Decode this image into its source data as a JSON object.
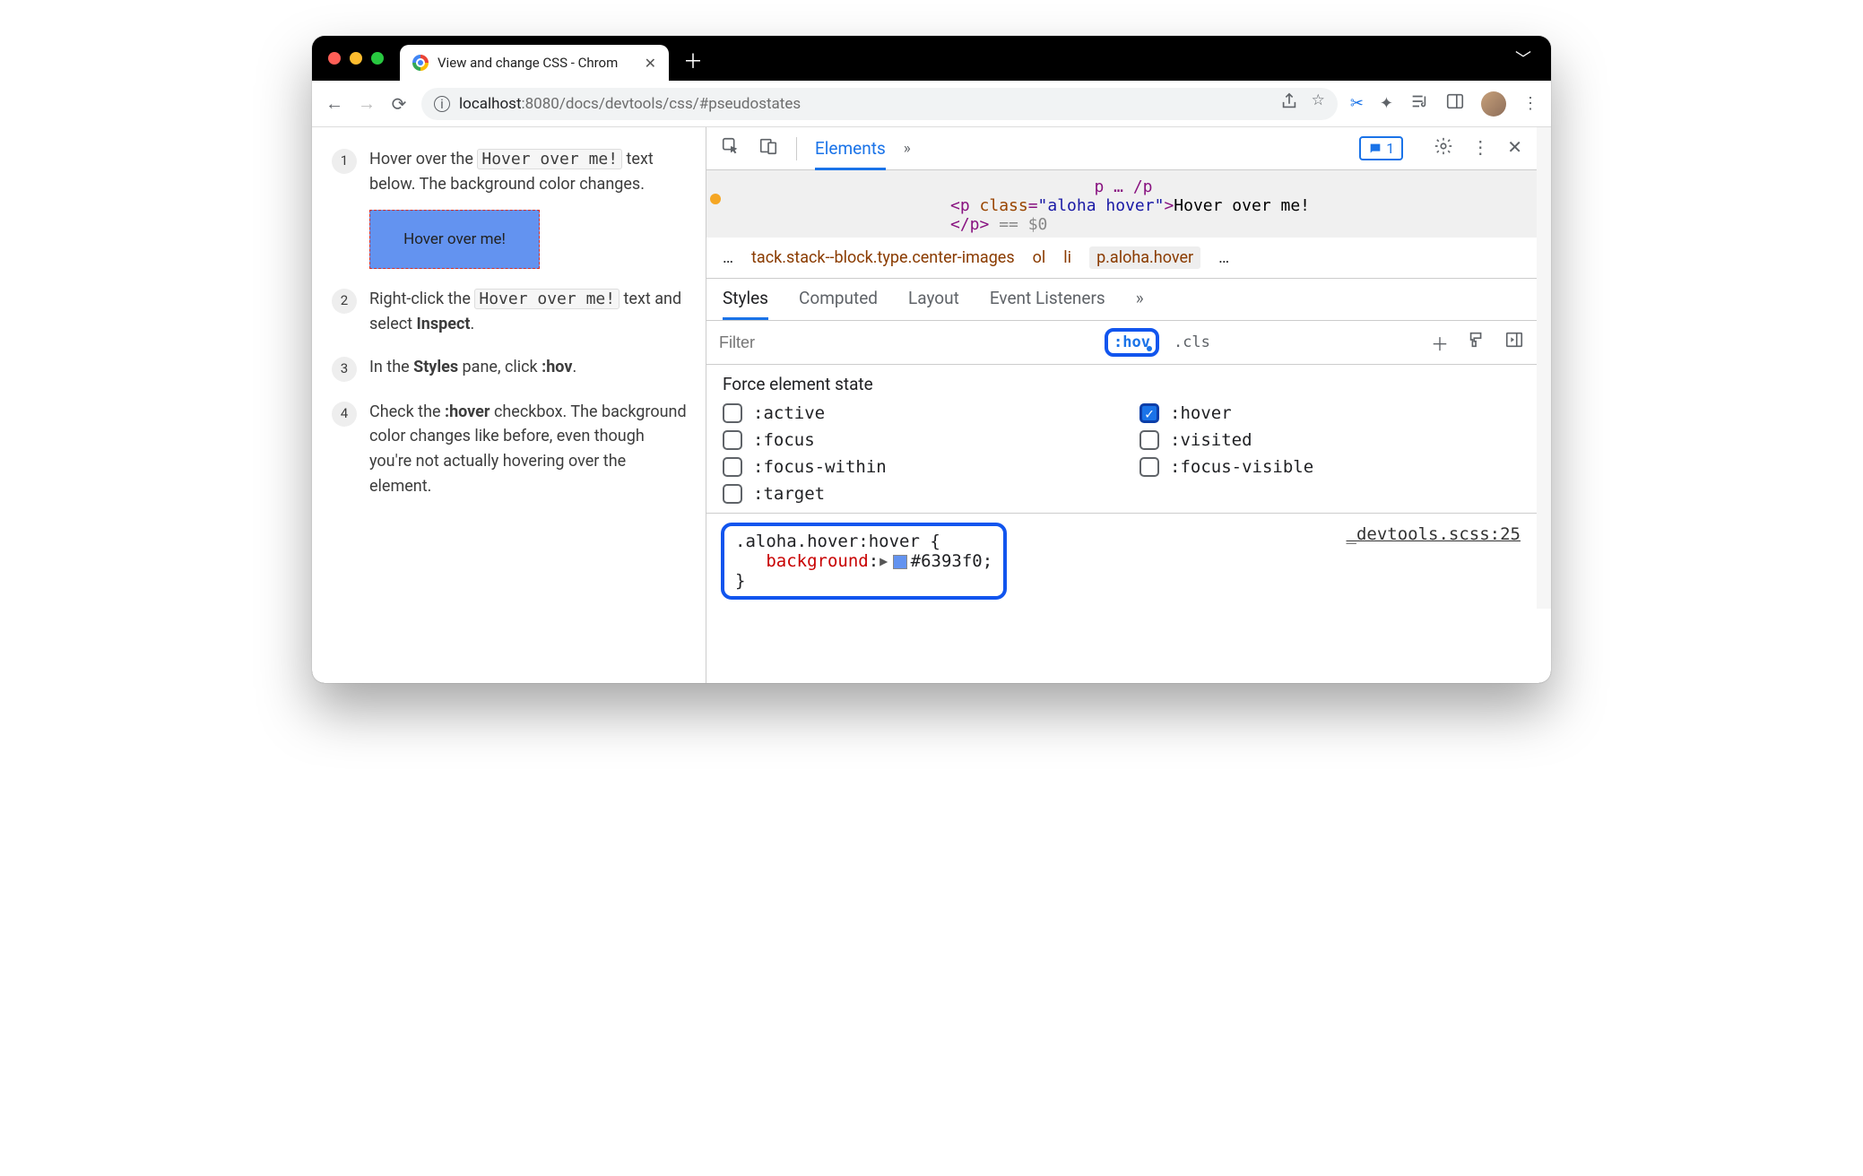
{
  "tab": {
    "title": "View and change CSS - Chrom"
  },
  "url": {
    "host": "localhost",
    "port": ":8080",
    "path": "/docs/devtools/css/#pseudostates"
  },
  "page": {
    "steps": [
      {
        "n": "1",
        "pre": "Hover over the ",
        "code": "Hover over me!",
        "post": " text below. The background color changes."
      },
      {
        "n": "2",
        "pre": "Right-click the ",
        "code": "Hover over me!",
        "post": " text and select ",
        "bold": "Inspect",
        "tail": "."
      },
      {
        "n": "3",
        "pre": "In the ",
        "bold": "Styles",
        "mid": " pane, click ",
        "bold2": ":hov",
        "tail": "."
      },
      {
        "n": "4",
        "pre": "Check the ",
        "bold": ":hover",
        "post": " checkbox. The background color changes like before, even though you're not actually hovering over the element."
      }
    ],
    "hover_demo": "Hover over me!"
  },
  "devtools": {
    "panel": "Elements",
    "issues_count": "1",
    "dom": {
      "tag_open": "<p ",
      "class_attr": "class",
      "class_val": "\"aloha hover\"",
      "text": "Hover over me!",
      "tag_close": "</p>",
      "var": "== $0"
    },
    "crumbs": {
      "ellipsis": "…",
      "long": "tack.stack--block.type.center-images",
      "ol": "ol",
      "li": "li",
      "sel": "p.aloha.hover",
      "more": "…"
    },
    "subtabs": {
      "styles": "Styles",
      "computed": "Computed",
      "layout": "Layout",
      "events": "Event Listeners"
    },
    "filter_placeholder": "Filter",
    "hov_label": ":hov",
    "cls_label": ".cls",
    "force_title": "Force element state",
    "states": {
      "active": ":active",
      "hover": ":hover",
      "focus": ":focus",
      "visited": ":visited",
      "focus_within": ":focus-within",
      "focus_visible": ":focus-visible",
      "target": ":target"
    },
    "rule": {
      "selector": ".aloha.hover:hover {",
      "prop": "background",
      "value": "#6393f0;",
      "close": "}",
      "source": "_devtools.scss:25"
    }
  }
}
